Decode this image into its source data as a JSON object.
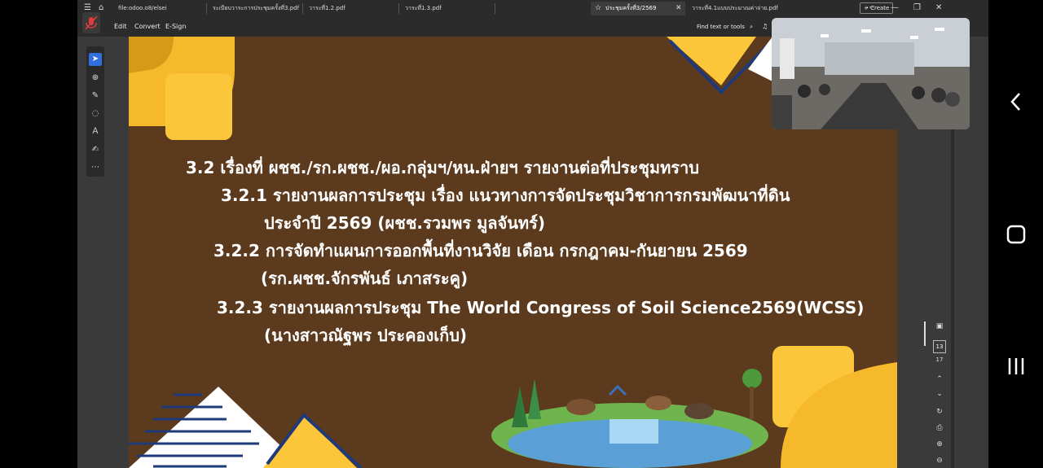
{
  "tabs": [
    {
      "label": "file:odoo.o8/elsei",
      "active": false
    },
    {
      "label": "ระเบียบวาระการประชุมครั้งที่3.pdf",
      "active": false
    },
    {
      "label": "วาระที่1.2.pdf",
      "active": false
    },
    {
      "label": "วาระที่1.3.pdf",
      "active": false
    },
    {
      "label": "ประชุมครั้งที่3/2569",
      "active": true
    },
    {
      "label": "วาระที่4.1แบบประมาณค่าจ่าย.pdf",
      "active": false
    }
  ],
  "new_tab_label": "+ Create",
  "menu": {
    "edit": "Edit",
    "convert": "Convert",
    "esign": "E-Sign",
    "find": "Find text or tools"
  },
  "page_nav": {
    "current": "13",
    "total": "17"
  },
  "slide": {
    "colors": {
      "background": "#5c3a1e",
      "accent": "#f6b92b",
      "navy": "#1e3a78"
    },
    "lines": [
      "3.2 เรื่องที่ ผชช./รก.ผชช./ผอ.กลุ่มฯ/หน.ฝ่ายฯ รายงานต่อที่ประชุมทราบ",
      "3.2.1 รายงานผลการประชุม เรื่อง แนวทางการจัดประชุมวิชาการกรมพัฒนาที่ดิน",
      "ประจำปี 2569 (ผชช.รวมพร มูลจันทร์)",
      "3.2.2 การจัดทำแผนการออกพื้นที่งานวิจัย เดือน กรกฎาคม-กันยายน 2569",
      "(รก.ผชช.จักรพันธ์ เภาสระคู)",
      "3.2.3 รายงานผลการประชุม The World Congress of Soil Science2569(WCSS)",
      "(นางสาวณัฐพร ประคองเก็บ)"
    ]
  },
  "icons": {
    "mic": "mic-muted-icon",
    "android_back": "back-chevron-icon",
    "android_home": "home-icon",
    "android_recents": "recents-icon"
  }
}
